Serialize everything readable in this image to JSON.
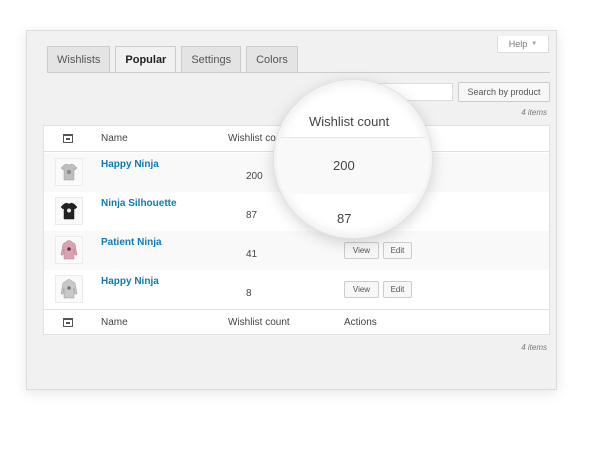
{
  "help": {
    "label": "Help",
    "caret": "▼"
  },
  "tabs": [
    {
      "label": "Wishlists",
      "active": false
    },
    {
      "label": "Popular",
      "active": true
    },
    {
      "label": "Settings",
      "active": false
    },
    {
      "label": "Colors",
      "active": false
    }
  ],
  "search": {
    "button_label": "Search by product",
    "value": ""
  },
  "items_count": "4 items",
  "table": {
    "headers": {
      "image": "image-icon",
      "name": "Name",
      "count": "Wishlist count",
      "actions": "Actions"
    },
    "rows": [
      {
        "name": "Happy Ninja",
        "count": "200",
        "shirt": "tshirt-grey",
        "color": "#bfbfbf"
      },
      {
        "name": "Ninja Silhouette",
        "count": "87",
        "shirt": "tshirt-black",
        "color": "#222222"
      },
      {
        "name": "Patient Ninja",
        "count": "41",
        "shirt": "hoodie-pink",
        "color": "#d9a3b3",
        "view": "View",
        "edit": "Edit"
      },
      {
        "name": "Happy Ninja",
        "count": "8",
        "shirt": "hoodie-grey",
        "color": "#c8c8c8",
        "view": "View",
        "edit": "Edit"
      }
    ]
  },
  "magnifier": {
    "header": "Wishlist count",
    "value_1": "200",
    "value_2": "87"
  },
  "colors": {
    "link": "#0e7bb5",
    "panel_bg": "#f1f1f1"
  }
}
